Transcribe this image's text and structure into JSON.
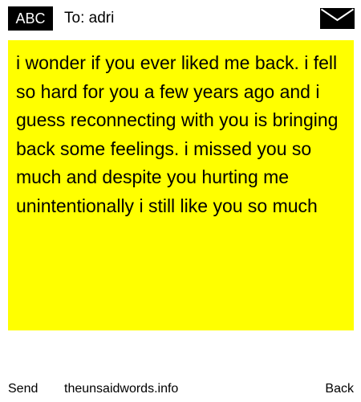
{
  "header": {
    "badge_label": "ABC",
    "to_label": "To: adri",
    "icon": "envelope-icon"
  },
  "message": {
    "body": "i wonder if you ever liked me back. i fell so hard for you a few years ago and i guess reconnecting with you is bringing back some feelings. i missed you so much and despite you hurting me unintentionally i still like you so much"
  },
  "footer": {
    "send_label": "Send",
    "site_label": "theunsaidwords.info",
    "back_label": "Back"
  },
  "colors": {
    "message_background": "#ffff00",
    "badge_background": "#000000",
    "badge_text": "#ffffff",
    "page_background": "#ffffff",
    "text": "#000000"
  }
}
